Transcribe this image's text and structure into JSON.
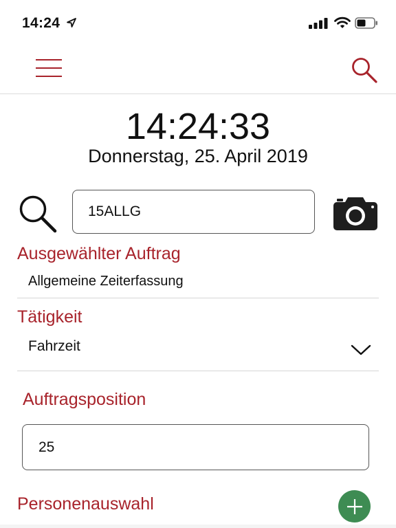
{
  "status_bar": {
    "time": "14:24",
    "icons": [
      "location-arrow-icon",
      "signal-icon",
      "wifi-icon",
      "battery-icon"
    ]
  },
  "nav": {
    "icons": [
      "menu-icon",
      "search-icon"
    ]
  },
  "clock": {
    "time": "14:24:33",
    "date": "Donnerstag, 25. April 2019"
  },
  "order_search": {
    "value": "15ALLG",
    "icons": [
      "search-icon",
      "camera-icon"
    ]
  },
  "selected_order": {
    "label": "Ausgewählter Auftrag",
    "value": "Allgemeine Zeiterfassung"
  },
  "activity": {
    "label": "Tätigkeit",
    "value": "Fahrzeit",
    "icon": "chevron-down-icon"
  },
  "order_position": {
    "label": "Auftragsposition",
    "value": "25"
  },
  "persons": {
    "label": "Personenauswahl",
    "icon": "plus-icon"
  },
  "colors": {
    "accent": "#a8232b",
    "add_button": "#3e8c53",
    "text": "#111111"
  }
}
